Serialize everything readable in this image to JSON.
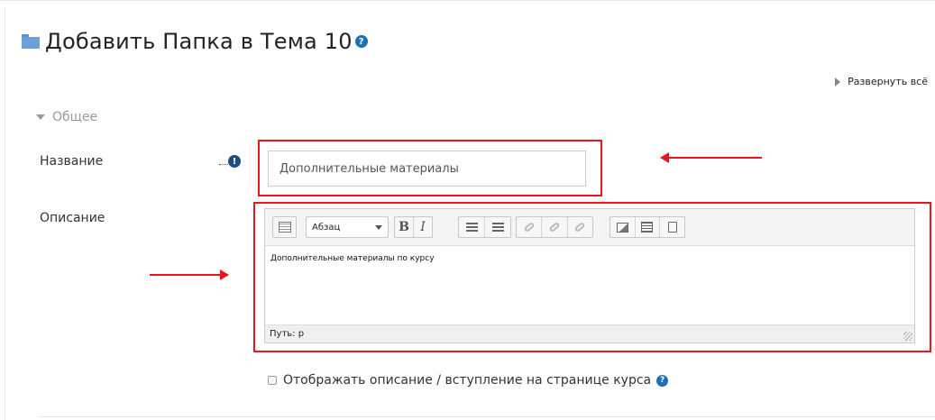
{
  "page": {
    "title": "Добавить Папка в Тема 10",
    "expand_all": "Развернуть всё",
    "section_general": "Общее"
  },
  "form": {
    "name_label": "Название",
    "name_value": "Дополнительные материалы",
    "description_label": "Описание",
    "editor": {
      "format_select": "Абзац",
      "content": "Дополнительные материалы по курсу",
      "path": "Путь: p"
    },
    "show_description_label": "Отображать описание / вступление на странице курса"
  },
  "icons": {
    "folder": "folder-icon",
    "help": "help-icon",
    "required": "required-icon"
  },
  "colors": {
    "annotation_red": "#e8161d",
    "help_blue": "#1f6fb2",
    "folder_blue": "#6c9fd6"
  }
}
